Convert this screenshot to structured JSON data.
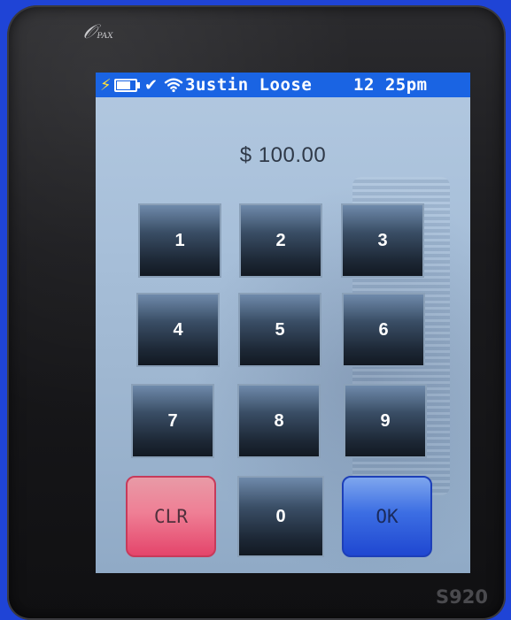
{
  "device": {
    "brand": "PAX",
    "model": "S920"
  },
  "status_bar": {
    "charging_icon": "lightning-bolt-icon",
    "battery_icon": "battery-icon",
    "battery_level": 0.85,
    "check_icon": "checkmark-icon",
    "wifi_icon": "wifi-icon",
    "text": "3ustin Loose",
    "time": "12 25pm"
  },
  "amount": "$ 100.00",
  "keypad": {
    "keys": [
      "1",
      "2",
      "3",
      "4",
      "5",
      "6",
      "7",
      "8",
      "9"
    ],
    "clear_label": "CLR",
    "zero_label": "0",
    "ok_label": "OK"
  },
  "colors": {
    "status_bar": "#1a64e3",
    "clear_button": "#ef7f95",
    "ok_button": "#3c6ee3",
    "key": "#3a4e66",
    "background": "#1f44d6"
  }
}
